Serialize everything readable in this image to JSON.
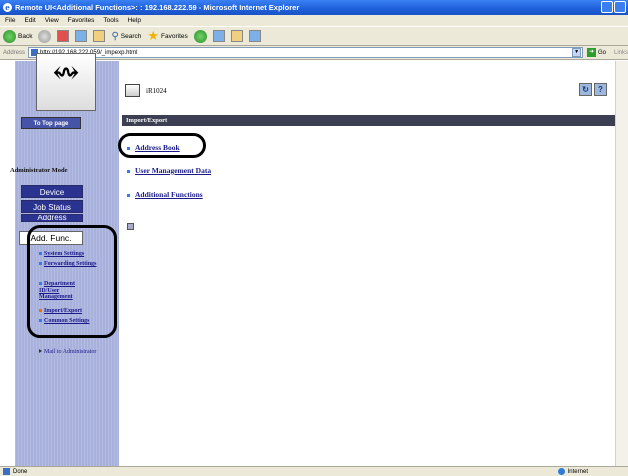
{
  "window": {
    "title": "Remote UI<Additional Functions>: : 192.168.222.59 - Microsoft Internet Explorer"
  },
  "menu": [
    "File",
    "Edit",
    "View",
    "Favorites",
    "Tools",
    "Help"
  ],
  "toolbar": {
    "back": "Back",
    "search": "Search",
    "favorites": "Favorites"
  },
  "address": {
    "label": "Address",
    "url": "http://192.168.222.059/_impexp.html",
    "go": "Go",
    "links": "Links"
  },
  "sidebar": {
    "to_top": "To Top page",
    "admin_mode": "Administrator Mode",
    "buttons": [
      "Device",
      "Job Status",
      "Address",
      "Add. Func."
    ],
    "sub_items": [
      "System Settings",
      "Forwarding Settings",
      "Department ID/User Management",
      "Import/Export",
      "Common Settings"
    ],
    "mail_to": "Mail to Administrator"
  },
  "main": {
    "device_name": "iR1024",
    "section_title": "Import/Export",
    "links": [
      "Address Book",
      "User Management Data",
      "Additional Functions"
    ]
  },
  "status": {
    "left": "Done",
    "zone": "Internet"
  }
}
